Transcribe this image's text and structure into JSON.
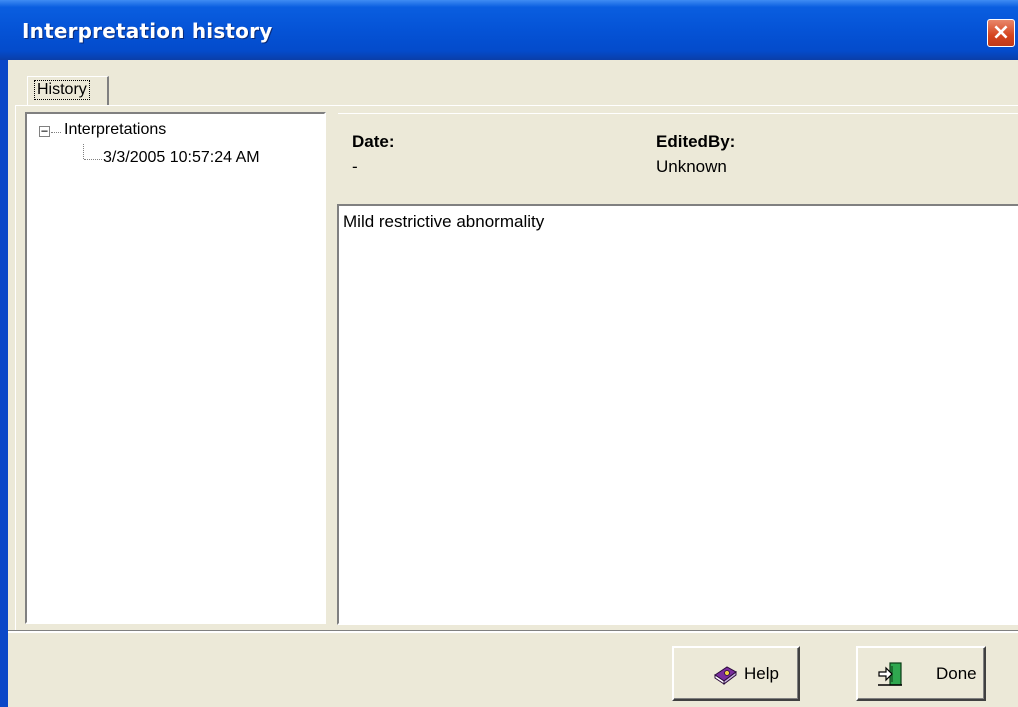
{
  "window": {
    "title": "Interpretation history",
    "close_icon": "close-icon",
    "colors": {
      "titlebar": "#0553D6",
      "close": "#D5441E",
      "face": "#ECE9D8"
    }
  },
  "tabs": [
    {
      "label": "History",
      "selected": true
    }
  ],
  "tree": {
    "root": {
      "label": "Interpretations",
      "expanded": true
    },
    "children": [
      {
        "label": "3/3/2005 10:57:24 AM"
      }
    ]
  },
  "details": {
    "date_label": "Date:",
    "date_value": "-",
    "edited_by_label": "EditedBy:",
    "edited_by_value": "Unknown",
    "text": "Mild restrictive abnormality"
  },
  "buttons": {
    "help": {
      "label": "Help",
      "icon": "help-book-icon"
    },
    "done": {
      "label": "Done",
      "icon": "exit-door-icon"
    }
  }
}
